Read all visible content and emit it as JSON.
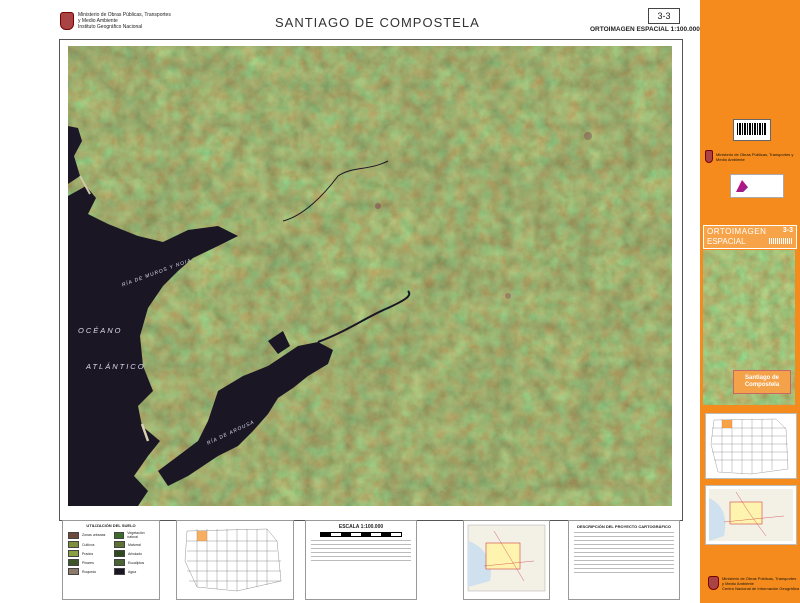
{
  "header": {
    "ministry_lines": [
      "Ministerio de Obras Públicas, Transportes",
      "y Medio Ambiente",
      "Instituto Geográfico Nacional"
    ],
    "title": "SANTIAGO DE COMPOSTELA",
    "sheet_number": "3-3",
    "subtitle": "ORTOIMAGEN ESPACIAL 1:100.000"
  },
  "map_labels": {
    "ocean_1": "OCÉANO",
    "ocean_2": "ATLÁNTICO",
    "ria_1": "RÍA DE MUROS Y NOIA",
    "ria_2": "RÍA DE AROUSA"
  },
  "legend": {
    "title": "UTILIZACIÓN DEL SUELO",
    "items": [
      {
        "label": "Zonas urbanas",
        "color": "#6b4a3a"
      },
      {
        "label": "Vegetación natural",
        "color": "#3d6b2a"
      },
      {
        "label": "Cultivos",
        "color": "#7e8f3a"
      },
      {
        "label": "Matorral",
        "color": "#5e7034"
      },
      {
        "label": "Prados",
        "color": "#8aa045"
      },
      {
        "label": "Arbolado",
        "color": "#2f4a1e"
      },
      {
        "label": "Pinares",
        "color": "#3c5528"
      },
      {
        "label": "Eucaliptos",
        "color": "#4b6332"
      },
      {
        "label": "Roquedo",
        "color": "#8c7a6a"
      },
      {
        "label": "Agua",
        "color": "#1a1624"
      }
    ]
  },
  "scale": {
    "title": "ESCALA 1:100.000"
  },
  "description": {
    "title": "DESCRIPCIÓN DEL PROYECTO CARTOGRÁFICO"
  },
  "sidebar": {
    "ortho_label_1": "ORTOIMAGEN",
    "ortho_label_2": "ESPACIAL",
    "ortho_number": "3-3",
    "cover_title_1": "Santiago de",
    "cover_title_2": "Compostela",
    "ministry_line": "Ministerio de Obras Públicas, Transportes y Medio Ambiente",
    "bottom_ministry_lines": [
      "Ministerio de Obras Públicas, Transportes",
      "y Medio Ambiente",
      "Centro Nacional de Información Geográfica"
    ],
    "colors": {
      "orange": "#f58b1c",
      "light_orange": "#f6a34a"
    }
  }
}
